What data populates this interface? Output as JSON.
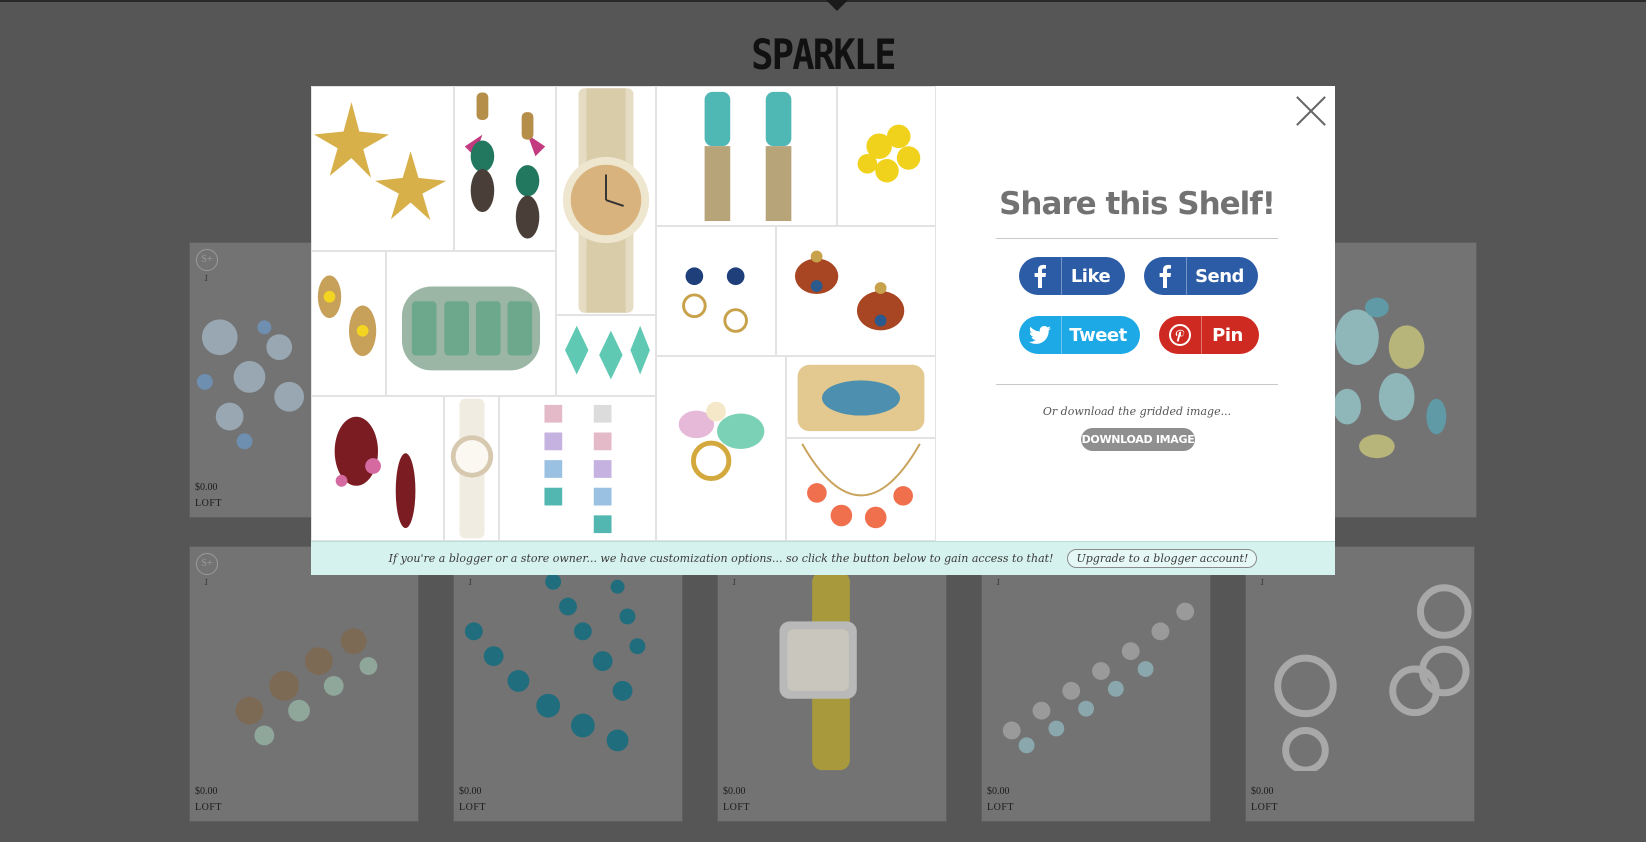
{
  "page": {
    "title": "SPARKLE"
  },
  "modal": {
    "share_title": "Share this Shelf!",
    "buttons": {
      "like": "Like",
      "send": "Send",
      "tweet": "Tweet",
      "pin": "Pin"
    },
    "download_text": "Or download the gridded image...",
    "download_button": "DOWNLOAD IMAGE",
    "footer_message": "If you're a blogger or a store owner... we have customization options... so click the button below to gain access to that!",
    "upgrade_button": "Upgrade to a blogger account!"
  },
  "products": [
    {
      "price": "$0.00",
      "store": "LOFT",
      "index": "1",
      "plus": "S+"
    },
    {
      "price": "$0.00",
      "store": "LOFT",
      "index": "1",
      "plus": "S+"
    },
    {
      "price": "$0.00",
      "store": "LOFT",
      "index": "1"
    },
    {
      "price": "$0.00",
      "store": "LOFT",
      "index": "1"
    },
    {
      "price": "$0.00",
      "store": "LOFT",
      "index": "1"
    },
    {
      "price": "$0.00",
      "store": "LOFT",
      "index": "1"
    },
    {
      "price": "$0.00",
      "store": "LOFT",
      "index": "1"
    }
  ],
  "icons": {
    "close": "close-icon",
    "facebook": "facebook-icon",
    "twitter": "twitter-icon",
    "pinterest": "pinterest-icon"
  },
  "colors": {
    "facebook": "#2c5ca6",
    "twitter": "#1da8e6",
    "pinterest": "#cf2a22",
    "footer_bg": "#d6f2ee",
    "overlay": "#565656"
  }
}
